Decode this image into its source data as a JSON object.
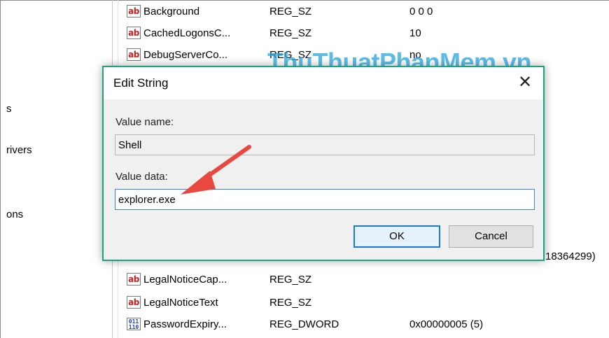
{
  "tree": {
    "items": [
      {
        "label": "s"
      },
      {
        "label": "rivers"
      },
      {
        "label": "ons"
      }
    ]
  },
  "values": {
    "rows_top": [
      {
        "icon": "string-value-icon",
        "name": "Background",
        "type": "REG_SZ",
        "data": "0 0 0"
      },
      {
        "icon": "string-value-icon",
        "name": "CachedLogonsC...",
        "type": "REG_SZ",
        "data": "10"
      },
      {
        "icon": "string-value-icon",
        "name": "DebugServerCo...",
        "type": "REG_SZ",
        "data": "no"
      }
    ],
    "partial_row_data": "18364299)",
    "rows_bottom": [
      {
        "icon": "string-value-icon",
        "name": "LegalNoticeCap...",
        "type": "REG_SZ",
        "data": ""
      },
      {
        "icon": "string-value-icon",
        "name": "LegalNoticeText",
        "type": "REG_SZ",
        "data": ""
      },
      {
        "icon": "dword-value-icon",
        "name": "PasswordExpiry...",
        "type": "REG_DWORD",
        "data": "0x00000005 (5)"
      }
    ],
    "icon_text_ab": "ab",
    "icon_text_dword": "011 110"
  },
  "watermark": "ThuThuatPhanMem.vn",
  "dialog": {
    "title": "Edit String",
    "close_glyph": "✕",
    "value_name_label": "Value name:",
    "value_name": "Shell",
    "value_data_label": "Value data:",
    "value_data": "explorer.exe",
    "ok_label": "OK",
    "cancel_label": "Cancel"
  },
  "colors": {
    "dialog_border": "#1aa37f",
    "annotation_arrow": "#e8483f",
    "watermark": "#29a8e0",
    "focus_border": "#3584e4"
  }
}
